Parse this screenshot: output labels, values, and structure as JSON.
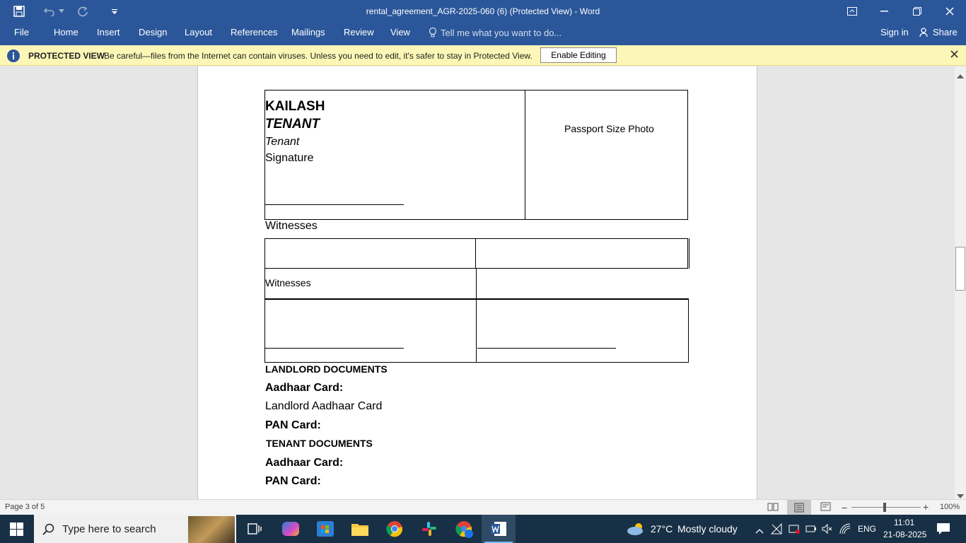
{
  "window": {
    "title": "rental_agreement_AGR-2025-060 (6) (Protected View) - Word"
  },
  "ribbon": {
    "tabs": [
      "File",
      "Home",
      "Insert",
      "Design",
      "Layout",
      "References",
      "Mailings",
      "Review",
      "View"
    ],
    "tell_me": "Tell me what you want to do...",
    "sign_in": "Sign in",
    "share": "Share"
  },
  "protected_view": {
    "label": "PROTECTED VIEW",
    "message": "Be careful—files from the Internet can contain viruses. Unless you need to edit, it's safer to stay in Protected View.",
    "button": "Enable Editing"
  },
  "document": {
    "tenant_name": "KAILASH",
    "tenant_role": "TENANT",
    "tenant_role2": "Tenant",
    "signature": "Signature",
    "photo_label": "Passport Size Photo",
    "witnesses_heading": "Witnesses",
    "witnesses_cell": "Witnesses",
    "landlord_docs": "LANDLORD DOCUMENTS",
    "aadhaar_label": "Aadhaar Card:",
    "landlord_aadhaar": "Landlord Aadhaar Card",
    "pan_label": "PAN Card:",
    "tenant_docs": "TENANT DOCUMENTS",
    "aadhaar_label2": "Aadhaar Card:",
    "pan_label2": "PAN Card:"
  },
  "statusbar": {
    "page": "Page 3 of 5",
    "zoom": "100%"
  },
  "taskbar": {
    "search_placeholder": "Type here to search",
    "weather_temp": "27°C",
    "weather_desc": "Mostly cloudy",
    "lang": "ENG",
    "time": "11:01",
    "date": "21-08-2025"
  },
  "colors": {
    "word_blue": "#2b579a",
    "protected_yellow": "#fcf7b6",
    "taskbar": "#183046"
  }
}
